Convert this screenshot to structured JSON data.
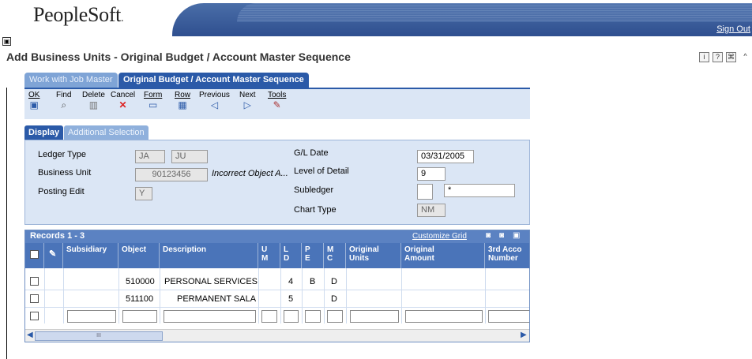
{
  "brand": {
    "logo": "PeopleSoft",
    "logo_mark": "."
  },
  "header": {
    "sign_out": "Sign Out"
  },
  "page_title": "Add Business Units - Original Budget / Account Master Sequence",
  "tabs": [
    {
      "label": "Work with Job Master"
    },
    {
      "label": "Original Budget / Account Master Sequence"
    }
  ],
  "top_icons": [
    "i",
    "?",
    "⌘",
    "^"
  ],
  "toolbar": {
    "ok": "OK",
    "find": "Find",
    "delete": "Delete",
    "cancel": "Cancel",
    "form": "Form",
    "row": "Row",
    "previous": "Previous",
    "next": "Next",
    "tools": "Tools"
  },
  "subtabs": {
    "display": "Display",
    "additional": "Additional Selection"
  },
  "form": {
    "ledger_type_label": "Ledger Type",
    "ledger_type_1": "JA",
    "ledger_type_2": "JU",
    "business_unit_label": "Business Unit",
    "business_unit": "90123456",
    "object_note": "Incorrect Object A...",
    "posting_edit_label": "Posting Edit",
    "posting_edit": "Y",
    "gl_date_label": "G/L Date",
    "gl_date": "03/31/2005",
    "level_of_detail_label": "Level of Detail",
    "level_of_detail": "9",
    "subledger_label": "Subledger",
    "subledger_1": "",
    "subledger_2": "*",
    "chart_type_label": "Chart Type",
    "chart_type": "NM"
  },
  "grid": {
    "records": "Records 1 - 3",
    "customize": "Customize Grid",
    "columns": {
      "subsidiary": "Subsidiary",
      "object": "Object",
      "description": "Description",
      "um": "U\nM",
      "ld": "L\nD",
      "pe": "P\nE",
      "mc": "M\nC",
      "orig_units": "Original\nUnits",
      "orig_amount": "Original\nAmount",
      "third_acct": "3rd Acco\nNumber"
    },
    "rows": [
      {
        "object": "510000",
        "description": "PERSONAL SERVICES",
        "ld": "4",
        "pe": "B",
        "mc": "D"
      },
      {
        "object": "511100",
        "description": "PERMANENT SALAF",
        "ld": "5",
        "pe": "",
        "mc": "D"
      }
    ],
    "scroll_thumb": "III"
  }
}
